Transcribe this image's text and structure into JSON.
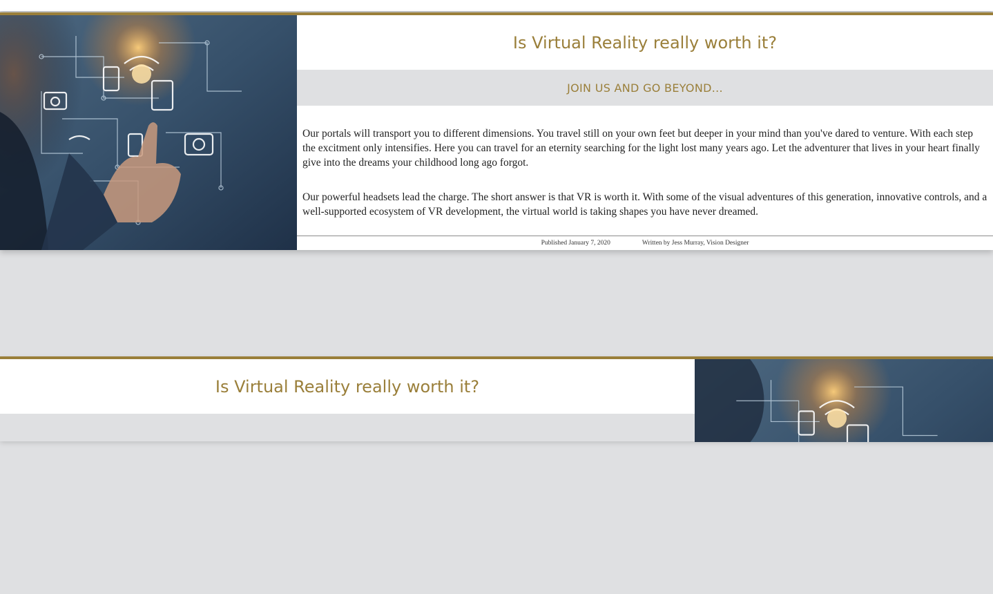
{
  "articles": [
    {
      "title": "Is Virtual Reality really worth it?",
      "subtitle": "JOIN US AND GO BEYOND...",
      "paragraphs": [
        "Our portals will transport you to different dimensions. You travel still on your own feet but deeper in your mind than you've dared to venture. With each step the excitment only intensifies. Here you can travel for an eternity searching for the light lost many years ago. Let the adventurer that lives in your heart finally give into the dreams your childhood long ago forgot.",
        "Our powerful headsets lead the charge. The short answer is that VR is worth it. With some of the visual adventures of this generation, innovative controls, and a well-supported ecosystem of VR development, the virtual world is taking shapes you have never dreamed."
      ],
      "published": "Published January 7, 2020",
      "author": "Written by Jess Murray, Vision Designer"
    },
    {
      "title": "Is Virtual Reality really worth it?"
    }
  ],
  "colors": {
    "accent": "#9a7f3a",
    "page_background": "#dfe0e2"
  }
}
